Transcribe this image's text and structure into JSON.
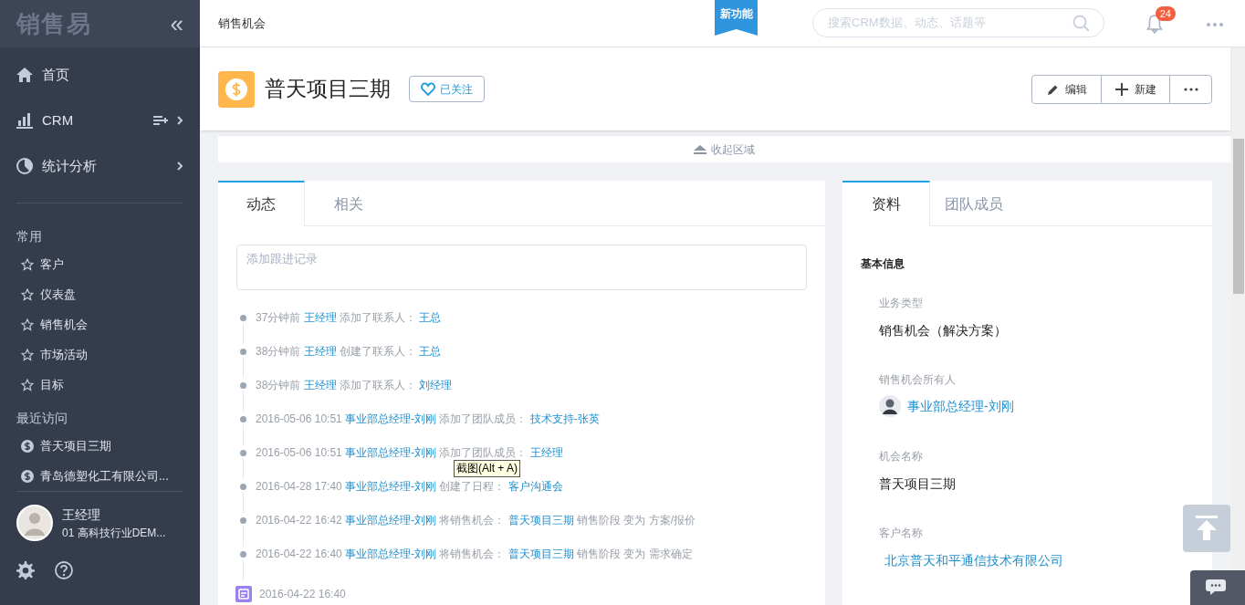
{
  "sidebar": {
    "logo": "销售易",
    "collapse": "«",
    "nav": [
      {
        "label": "首页",
        "chevron": false,
        "extra": false
      },
      {
        "label": "CRM",
        "chevron": true,
        "extra": true
      },
      {
        "label": "统计分析",
        "chevron": true,
        "extra": false
      }
    ],
    "favorites_title": "常用",
    "favorites": [
      "客户",
      "仪表盘",
      "销售机会",
      "市场活动",
      "目标"
    ],
    "recent_title": "最近访问",
    "recent": [
      "普天项目三期",
      "青岛德塑化工有限公司..."
    ],
    "user": {
      "name": "王经理",
      "org": "01 高科技行业DEM..."
    }
  },
  "header": {
    "breadcrumb": "销售机会",
    "ribbon": "新功能",
    "search": {
      "placeholder": "搜索CRM数据、动态、话题等"
    },
    "notifications": "24"
  },
  "record": {
    "title": "普天项目三期",
    "follow": "已关注",
    "actions": [
      "编辑",
      "新建"
    ],
    "collapse": "收起区域"
  },
  "activity": {
    "tabs": [
      {
        "label": "动态",
        "selected": true
      },
      {
        "label": "相关",
        "selected": false
      }
    ],
    "input": {
      "placeholder": "添加跟进记录"
    },
    "items": [
      {
        "kind": "event",
        "time": "37分钟前",
        "parts": [
          {
            "text": "王经理",
            "link": true
          },
          {
            "text": "添加了联系人：",
            "link": false
          },
          {
            "text": "王总",
            "link": true
          }
        ]
      },
      {
        "kind": "event",
        "time": "38分钟前",
        "parts": [
          {
            "text": "王经理",
            "link": true
          },
          {
            "text": "创建了联系人：",
            "link": false
          },
          {
            "text": "王总",
            "link": true
          }
        ]
      },
      {
        "kind": "event",
        "time": "38分钟前",
        "parts": [
          {
            "text": "王经理",
            "link": true
          },
          {
            "text": "添加了联系人：",
            "link": false
          },
          {
            "text": "刘经理",
            "link": true
          }
        ]
      },
      {
        "kind": "event",
        "time": "2016-05-06 10:51",
        "parts": [
          {
            "text": "事业部总经理-刘刚",
            "link": true
          },
          {
            "text": "添加了团队成员：",
            "link": false
          },
          {
            "text": "技术支持-张英",
            "link": true
          }
        ]
      },
      {
        "kind": "event",
        "time": "2016-05-06 10:51",
        "parts": [
          {
            "text": "事业部总经理-刘刚",
            "link": true
          },
          {
            "text": "添加了团队成员：",
            "link": false
          },
          {
            "text": "王经理",
            "link": true
          }
        ]
      },
      {
        "kind": "event",
        "time": "2016-04-28 17:40",
        "parts": [
          {
            "text": "事业部总经理-刘刚",
            "link": true
          },
          {
            "text": "创建了日程：",
            "link": false
          },
          {
            "text": "客户沟通会",
            "link": true
          }
        ]
      },
      {
        "kind": "event",
        "time": "2016-04-22 16:42",
        "parts": [
          {
            "text": "事业部总经理-刘刚",
            "link": true
          },
          {
            "text": "将销售机会：",
            "link": false
          },
          {
            "text": "普天项目三期",
            "link": true
          },
          {
            "text": "销售阶段 变为 方案/报价",
            "link": false
          }
        ]
      },
      {
        "kind": "event",
        "time": "2016-04-22 16:40",
        "parts": [
          {
            "text": "事业部总经理-刘刚",
            "link": true
          },
          {
            "text": "将销售机会：",
            "link": false
          },
          {
            "text": "普天项目三期",
            "link": true
          },
          {
            "text": "销售阶段 变为 需求确定",
            "link": false
          }
        ]
      },
      {
        "kind": "schedule",
        "time": "2016-04-22 16:40"
      }
    ],
    "tooltip": "截图(Alt + A)"
  },
  "details": {
    "tabs": [
      {
        "label": "资料",
        "selected": true
      },
      {
        "label": "团队成员",
        "selected": false
      }
    ],
    "section": "基本信息",
    "fields": [
      {
        "label": "业务类型",
        "value": "销售机会（解决方案）",
        "kind": "text"
      },
      {
        "label": "销售机会所有人",
        "value": "事业部总经理-刘刚",
        "kind": "person"
      },
      {
        "label": "机会名称",
        "value": "普天项目三期",
        "kind": "text"
      },
      {
        "label": "客户名称",
        "value": "北京普天和平通信技术有限公司",
        "kind": "link"
      }
    ]
  }
}
